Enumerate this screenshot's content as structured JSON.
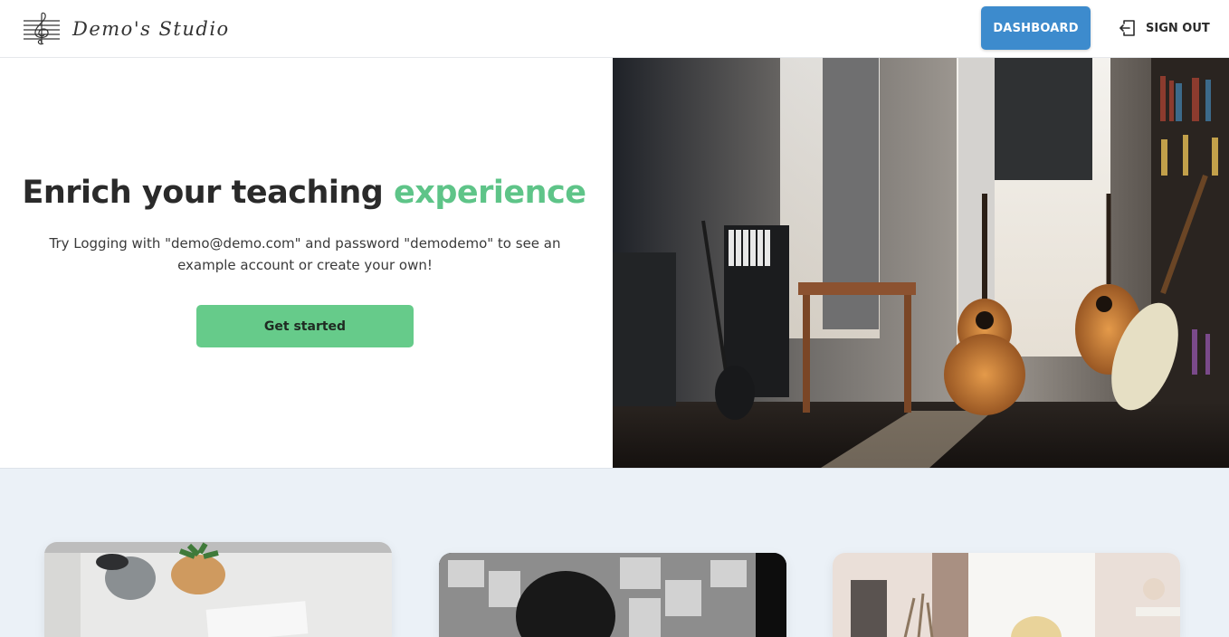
{
  "header": {
    "brand_name": "Demo's Studio",
    "brand_icon": "treble-clef-icon",
    "dashboard_label": "DASHBOARD",
    "signout_label": "SIGN OUT",
    "signout_icon": "sign-out-icon"
  },
  "hero": {
    "title_main": "Enrich your teaching ",
    "title_accent": "experience",
    "subtitle": "Try Logging with \"demo@demo.com\" and password \"demodemo\" to see an example account or create your own!",
    "cta_label": "Get started",
    "image": "music-studio-with-guitars-photo"
  },
  "features": {
    "cards": [
      {
        "image": "desk-with-plant-photo"
      },
      {
        "image": "person-at-wall-of-posters-photo"
      },
      {
        "image": "bright-room-photo"
      }
    ]
  },
  "colors": {
    "accent_green": "#5ec488",
    "button_green": "#66cb8a",
    "dashboard_blue": "#3d8bcd",
    "lower_bg": "#ebf1f7"
  }
}
